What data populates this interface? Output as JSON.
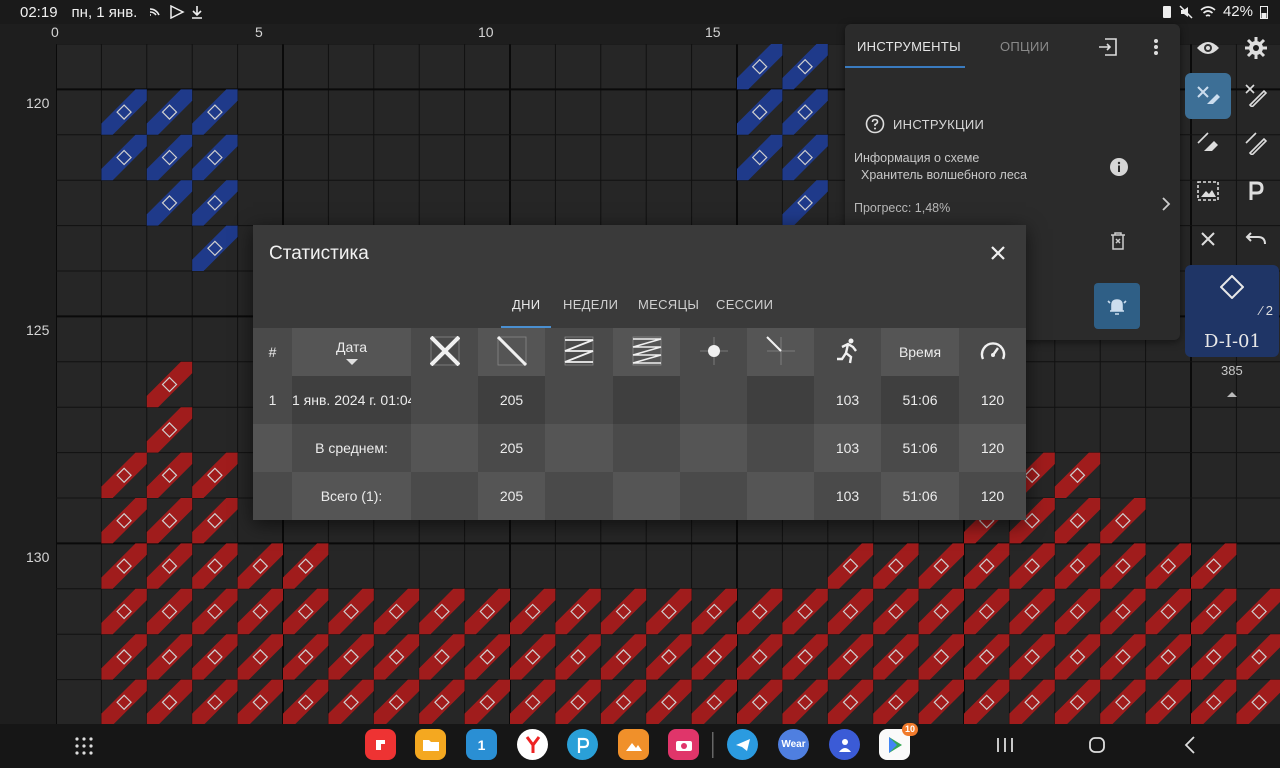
{
  "status_bar": {
    "time": "02:19",
    "date": "пн, 1 янв.",
    "battery": "42%"
  },
  "ruler": {
    "columns": [
      "0",
      "5",
      "10",
      "15"
    ],
    "rows": [
      "120",
      "125",
      "130"
    ]
  },
  "tools_panel": {
    "tab_tools": "ИНСТРУМЕНТЫ",
    "tab_options": "ОПЦИИ",
    "instructions": "ИНСТРУКЦИИ",
    "info_title": "Информация о схеме",
    "info_name": "Хранитель волшебного леса",
    "progress": "Прогресс: 1,48%"
  },
  "symbol_card": {
    "code": "D-I-01",
    "fraction": "⁄ 2",
    "count": "385"
  },
  "dialog": {
    "title": "Статистика",
    "tabs": [
      "ДНИ",
      "НЕДЕЛИ",
      "МЕСЯЦЫ",
      "СЕССИИ"
    ],
    "headers": {
      "num": "#",
      "date": "Дата",
      "time": "Время"
    },
    "rows": [
      {
        "num": "1",
        "date": "1 янв. 2024 г. 01:04",
        "full": "",
        "half": "205",
        "back": "",
        "back2": "",
        "french": "",
        "quarter": "",
        "run": "103",
        "time": "51:06",
        "speed": "120"
      },
      {
        "num": "",
        "date": "В среднем:",
        "full": "",
        "half": "205",
        "back": "",
        "back2": "",
        "french": "",
        "quarter": "",
        "run": "103",
        "time": "51:06",
        "speed": "120"
      },
      {
        "num": "",
        "date": "Всего (1):",
        "full": "",
        "half": "205",
        "back": "",
        "back2": "",
        "french": "",
        "quarter": "",
        "run": "103",
        "time": "51:06",
        "speed": "120"
      }
    ]
  },
  "navbar": {
    "apps": [
      "yandex-disk",
      "files",
      "calendar",
      "yandex-browser",
      "picsart",
      "gallery",
      "camera",
      "telegram",
      "wear",
      "contacts",
      "play-store"
    ],
    "wear_label": "Wear",
    "play_badge": "10",
    "calendar_label": "1"
  },
  "colors": {
    "accent_blue": "#3a7bbf",
    "stitch_blue": "#1f3a8a",
    "stitch_red": "#a01c1c",
    "dialog_bg": "#3a3a3a"
  }
}
